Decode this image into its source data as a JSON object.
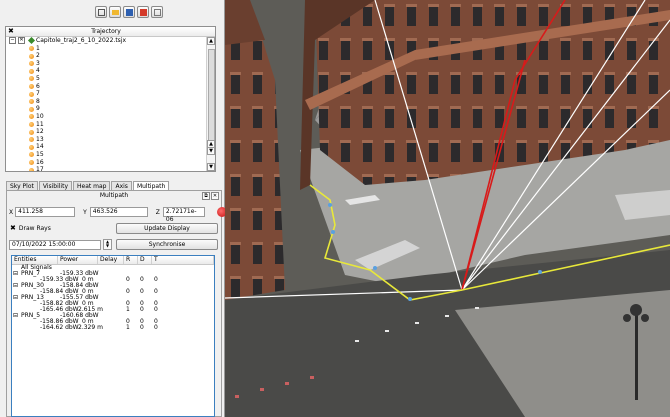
{
  "toolbar": {
    "icons": [
      "export-icon",
      "open-folder-icon",
      "save-icon",
      "close-red-icon",
      "settings-icon"
    ]
  },
  "trajectory": {
    "header": "Trajectory",
    "close_glyph": "✖",
    "root_label": "Capitole_traj2_6_10_2022.tsjx",
    "items": [
      "1",
      "2",
      "3",
      "4",
      "5",
      "6",
      "7",
      "8",
      "9",
      "10",
      "11",
      "12",
      "13",
      "14",
      "15",
      "16",
      "17"
    ]
  },
  "tabs": [
    "Sky Plot",
    "Visibility",
    "Heat map",
    "Axis",
    "Multipath"
  ],
  "active_tab": "Multipath",
  "multipath": {
    "title": "Multipath",
    "x_label": "X",
    "x_value": "411.258",
    "y_label": "Y",
    "y_value": "463.526",
    "z_label": "Z",
    "z_value": "2.72171e-06",
    "draw_rays_label": "Draw Rays",
    "draw_rays_glyph": "✖",
    "update_button": "Update Display",
    "datetime": "07/10/2022 15:00:00",
    "sync_button": "Synchronise",
    "columns": [
      "Entities",
      "Power",
      "Delay",
      "R",
      "D",
      "T"
    ],
    "rows": [
      {
        "c0": "All Signals",
        "c1": "",
        "c2": "",
        "c3": "",
        "c4": "",
        "c5": "",
        "indent": 1
      },
      {
        "c0": "PRN_7",
        "c1": "-159.33 dbW",
        "c2": "",
        "c3": "",
        "c4": "",
        "c5": "",
        "indent": 0
      },
      {
        "c0": "",
        "c1": "-159.33 dbW",
        "c2": "0 m",
        "c3": "0",
        "c4": "0",
        "c5": "0",
        "indent": 2
      },
      {
        "c0": "PRN_30",
        "c1": "-158.84 dbW",
        "c2": "",
        "c3": "",
        "c4": "",
        "c5": "",
        "indent": 0
      },
      {
        "c0": "",
        "c1": "-158.84 dbW",
        "c2": "0 m",
        "c3": "0",
        "c4": "0",
        "c5": "0",
        "indent": 2
      },
      {
        "c0": "PRN_13",
        "c1": "-155.57 dbW",
        "c2": "",
        "c3": "",
        "c4": "",
        "c5": "",
        "indent": 0
      },
      {
        "c0": "",
        "c1": "-158.82 dbW",
        "c2": "0 m",
        "c3": "0",
        "c4": "0",
        "c5": "0",
        "indent": 2
      },
      {
        "c0": "",
        "c1": "-165.46 dbW",
        "c2": "2.615 m",
        "c3": "1",
        "c4": "0",
        "c5": "0",
        "indent": 2
      },
      {
        "c0": "PRN_5",
        "c1": "-160.68 dbW",
        "c2": "",
        "c3": "",
        "c4": "",
        "c5": "",
        "indent": 0
      },
      {
        "c0": "",
        "c1": "-158.86 dbW",
        "c2": "0 m",
        "c3": "0",
        "c4": "0",
        "c5": "0",
        "indent": 2
      },
      {
        "c0": "",
        "c1": "-164.62 dbW",
        "c2": "2.329 m",
        "c3": "1",
        "c4": "0",
        "c5": "0",
        "indent": 2
      }
    ]
  },
  "colors": {
    "trajectory_line": "#e8e83a",
    "direct_ray": "#ffffff",
    "reflected_ray": "#d81a1a",
    "building": "#7a4a36",
    "accent": "#3b7fbf"
  }
}
